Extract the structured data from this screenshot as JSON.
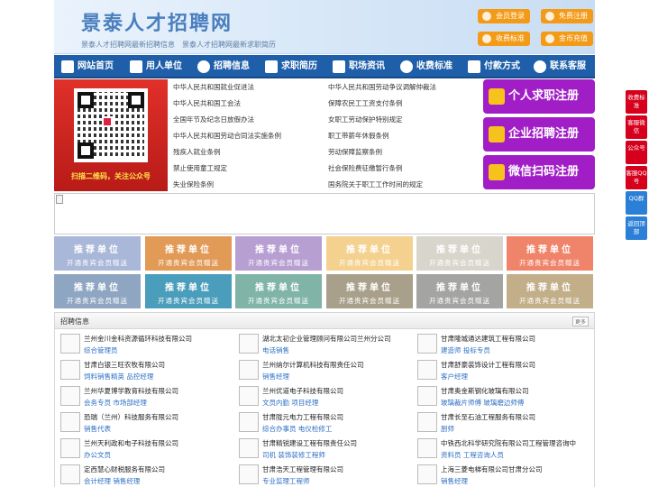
{
  "header": {
    "title": "景泰人才招聘网",
    "subtitle": "景泰人才招聘网最新招聘信息　景泰人才招聘网最新求职简历",
    "buttons": [
      "会员登录",
      "免费注册",
      "收费标准",
      "金币充值"
    ]
  },
  "nav": {
    "items": [
      "网站首页",
      "用人单位",
      "招聘信息",
      "求职简历",
      "职场资讯",
      "收费标准",
      "付款方式",
      "联系客服"
    ]
  },
  "qr": {
    "caption": "扫描二维码，关注公众号"
  },
  "laws": {
    "left": [
      "中华人民共和国就业促进法",
      "中华人民共和国工会法",
      "全国年节及纪念日放假办法",
      "中华人民共和国劳动合同法实施条例",
      "残疾人就业条例",
      "禁止使用童工规定",
      "失业保险条例"
    ],
    "right": [
      "中华人民共和国劳动争议调解仲裁法",
      "保障农民工工资支付条例",
      "女职工劳动保护特别规定",
      "职工带薪年休假条例",
      "劳动保障监察条例",
      "社会保险费征缴暂行条例",
      "国务院关于职工工作时间的规定"
    ]
  },
  "register": [
    "个人求职注册",
    "企业招聘注册",
    "微信扫码注册"
  ],
  "tiles": {
    "title": "推荐单位",
    "sub": "开通贵宾会员赠送",
    "colors": [
      "#a9b7d9",
      "#e29a57",
      "#b79fd2",
      "#f5d18f",
      "#d8d6cc",
      "#f0846a",
      "#8fa6c2",
      "#4a9dbb",
      "#7fb4a6",
      "#a8a08a",
      "#a4a4a2",
      "#c2ae88"
    ]
  },
  "jobs": {
    "title": "招聘信息",
    "more": "更多",
    "list": [
      {
        "company": "兰州金川金科资源循环科技有限公司",
        "positions": "综合管理员"
      },
      {
        "company": "湖北太初企业管理顾问有限公司兰州分公司",
        "positions": "电话销售"
      },
      {
        "company": "甘肃隆城通达建筑工程有限公司",
        "positions": "建造师 投标专员"
      },
      {
        "company": "甘肃白银三旺农牧有限公司",
        "positions": "饲料销售精英 品控经理"
      },
      {
        "company": "兰州纳尔计算机科技有限责任公司",
        "positions": "销售经理"
      },
      {
        "company": "甘肃舒豪装饰设计工程有限公司",
        "positions": "客户经理"
      },
      {
        "company": "兰州华夏博学教育科技有限公司",
        "positions": "会务专员 市场部经理"
      },
      {
        "company": "兰州优道电子科技有限公司",
        "positions": "文员内勤 项目经理"
      },
      {
        "company": "甘肃奥金斯钢化玻璃有限公司",
        "positions": "玻璃裁片师傅 玻璃磨边师傅"
      },
      {
        "company": "恐瑞（兰州）科技服务有限公司",
        "positions": "销售代表"
      },
      {
        "company": "甘肃陇元电力工程有限公司",
        "positions": "综合办事员 电仪检修工"
      },
      {
        "company": "甘肃长至石油工程服务有限公司",
        "positions": "厨师"
      },
      {
        "company": "兰州天利政和电子科技有限公司",
        "positions": "办公文员"
      },
      {
        "company": "甘肃精锐建设工程有限责任公司",
        "positions": "司机 装饰装修工程师"
      },
      {
        "company": "中铁西北科学研究院有限公司工程管理咨询中",
        "positions": "资料员 工程咨询人员"
      },
      {
        "company": "定西慧心财税服务有限公司",
        "positions": "会计经理 销售经理"
      },
      {
        "company": "甘肃浩天工程管理有限公司",
        "positions": "专业监理工程师"
      },
      {
        "company": "上海三菱电梯有限公司甘肃分公司",
        "positions": "销售经理"
      }
    ]
  },
  "sidebar": [
    "收费标准",
    "客服微信",
    "公众号",
    "客服QQ号",
    "QQ群",
    "返回顶部"
  ]
}
